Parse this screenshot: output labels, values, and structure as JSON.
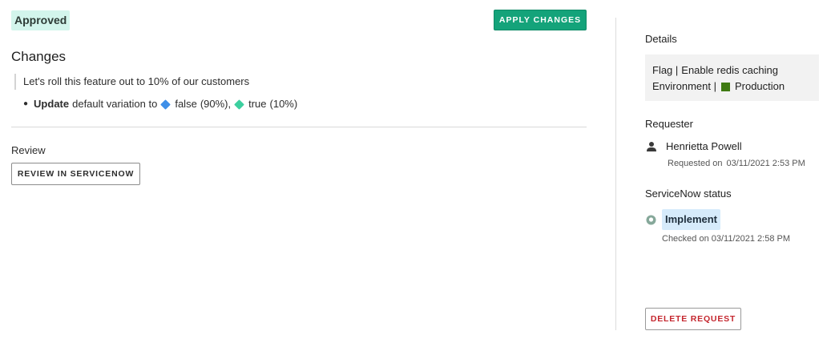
{
  "status": {
    "label": "Approved",
    "color": "#d3f5ec"
  },
  "actions": {
    "apply_label": "APPLY CHANGES",
    "apply_color": "#14a37a"
  },
  "changes": {
    "heading": "Changes",
    "description": "Let's roll this feature out to 10% of our customers",
    "instruction": {
      "action": "Update",
      "text": "default variation to",
      "variations": [
        {
          "label": "false",
          "percent": "(90%),",
          "color": "#3e8fe8",
          "icon": "diamond-icon"
        },
        {
          "label": "true",
          "percent": "(10%)",
          "color": "#3ccf9f",
          "icon": "diamond-icon"
        }
      ]
    }
  },
  "review": {
    "heading": "Review",
    "button_label": "REVIEW IN SERVICENOW"
  },
  "sidebar": {
    "details": {
      "heading": "Details",
      "flag_prefix": "Flag |",
      "flag_name": "Enable redis caching",
      "env_prefix": "Environment |",
      "env_name": "Production",
      "env_color": "#3f7a12"
    },
    "requester": {
      "heading": "Requester",
      "name": "Henrietta Powell",
      "icon": "person-icon",
      "requested_label": "Requested on",
      "requested_at": "03/11/2021 2:53 PM"
    },
    "servicenow": {
      "heading": "ServiceNow status",
      "icon": "status-circle-icon",
      "state": "Implement",
      "state_color": "#d6ebfb",
      "checked_text": "Checked on 03/11/2021 2:58 PM"
    },
    "delete_label": "DELETE REQUEST",
    "delete_color": "#c4262e"
  }
}
